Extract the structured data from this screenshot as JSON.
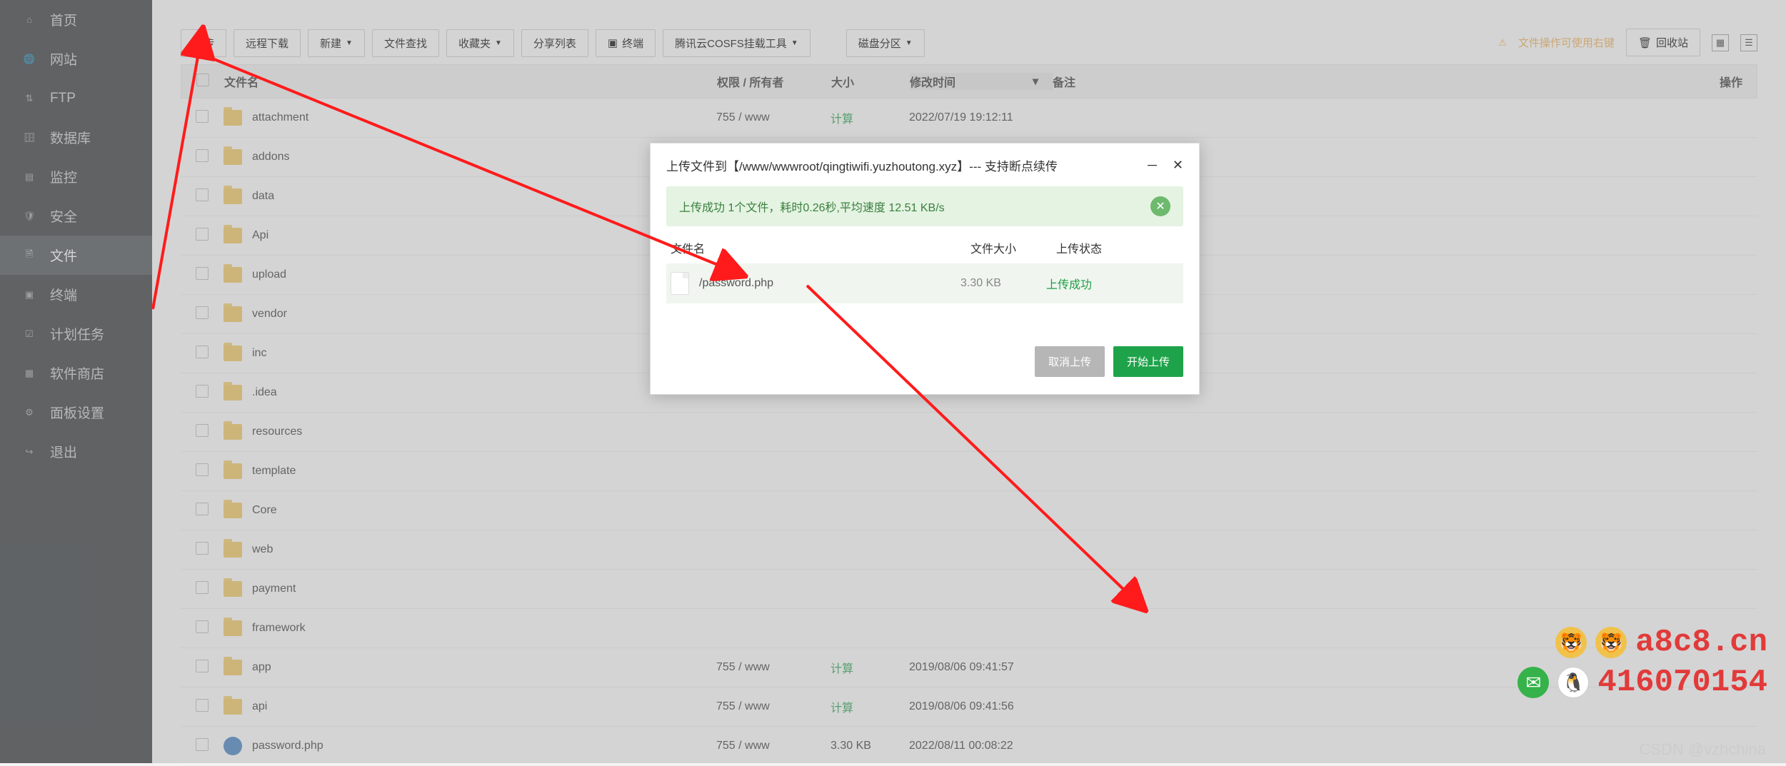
{
  "sidebar": [
    {
      "label": "首页",
      "icon": "home-icon",
      "active": false
    },
    {
      "label": "网站",
      "icon": "globe-icon",
      "active": false
    },
    {
      "label": "FTP",
      "icon": "ftp-icon",
      "active": false
    },
    {
      "label": "数据库",
      "icon": "database-icon",
      "active": false
    },
    {
      "label": "监控",
      "icon": "monitor-icon",
      "active": false
    },
    {
      "label": "安全",
      "icon": "shield-icon",
      "active": false
    },
    {
      "label": "文件",
      "icon": "file-icon",
      "active": true
    },
    {
      "label": "终端",
      "icon": "terminal-icon",
      "active": false
    },
    {
      "label": "计划任务",
      "icon": "cron-icon",
      "active": false
    },
    {
      "label": "软件商店",
      "icon": "store-icon",
      "active": false
    },
    {
      "label": "面板设置",
      "icon": "settings-icon",
      "active": false
    },
    {
      "label": "退出",
      "icon": "logout-icon",
      "active": false
    }
  ],
  "toolbar": {
    "upload": "上传",
    "remote_dl": "远程下载",
    "new": "新建",
    "find": "文件查找",
    "favorites": "收藏夹",
    "share": "分享列表",
    "terminal": "终端",
    "tencent": "腾讯云COSFS挂载工具",
    "disk": "磁盘分区",
    "tip": "文件操作可使用右键",
    "recycle": "回收站"
  },
  "table": {
    "head": {
      "name": "文件名",
      "perm": "权限 / 所有者",
      "size": "大小",
      "mtime": "修改时间",
      "notes": "备注",
      "ops": "操作"
    },
    "rows": [
      {
        "type": "folder",
        "name": "attachment",
        "perm": "755 / www",
        "size": "计算",
        "mtime": "2022/07/19 19:12:11"
      },
      {
        "type": "folder",
        "name": "addons",
        "perm": "",
        "size": "",
        "mtime": ""
      },
      {
        "type": "folder",
        "name": "data",
        "perm": "",
        "size": "",
        "mtime": ""
      },
      {
        "type": "folder",
        "name": "Api",
        "perm": "",
        "size": "",
        "mtime": ""
      },
      {
        "type": "folder",
        "name": "upload",
        "perm": "",
        "size": "",
        "mtime": ""
      },
      {
        "type": "folder",
        "name": "vendor",
        "perm": "",
        "size": "",
        "mtime": ""
      },
      {
        "type": "folder",
        "name": "inc",
        "perm": "",
        "size": "",
        "mtime": ""
      },
      {
        "type": "folder",
        "name": ".idea",
        "perm": "",
        "size": "",
        "mtime": ""
      },
      {
        "type": "folder",
        "name": "resources",
        "perm": "",
        "size": "",
        "mtime": ""
      },
      {
        "type": "folder",
        "name": "template",
        "perm": "",
        "size": "",
        "mtime": ""
      },
      {
        "type": "folder",
        "name": "Core",
        "perm": "",
        "size": "",
        "mtime": ""
      },
      {
        "type": "folder",
        "name": "web",
        "perm": "",
        "size": "",
        "mtime": ""
      },
      {
        "type": "folder",
        "name": "payment",
        "perm": "",
        "size": "",
        "mtime": ""
      },
      {
        "type": "folder",
        "name": "framework",
        "perm": "",
        "size": "",
        "mtime": ""
      },
      {
        "type": "folder",
        "name": "app",
        "perm": "755 / www",
        "size": "计算",
        "mtime": "2019/08/06 09:41:57"
      },
      {
        "type": "folder",
        "name": "api",
        "perm": "755 / www",
        "size": "计算",
        "mtime": "2019/08/06 09:41:56"
      },
      {
        "type": "file",
        "name": "password.php",
        "perm": "755 / www",
        "size": "3.30 KB",
        "mtime": "2022/08/11 00:08:22"
      }
    ]
  },
  "dialog": {
    "title": "上传文件到【/www/wwwroot/qingtiwifi.yuzhoutong.xyz】--- 支持断点续传",
    "success_msg": "上传成功 1个文件，耗时0.26秒,平均速度 12.51 KB/s",
    "col_name": "文件名",
    "col_size": "文件大小",
    "col_status": "上传状态",
    "file_name": "/password.php",
    "file_size": "3.30 KB",
    "file_status": "上传成功",
    "btn_cancel": "取消上传",
    "btn_start": "开始上传"
  },
  "contact": {
    "site": "a8c8.cn",
    "qq": "416070154"
  },
  "watermark": "CSDN @vzhchina"
}
